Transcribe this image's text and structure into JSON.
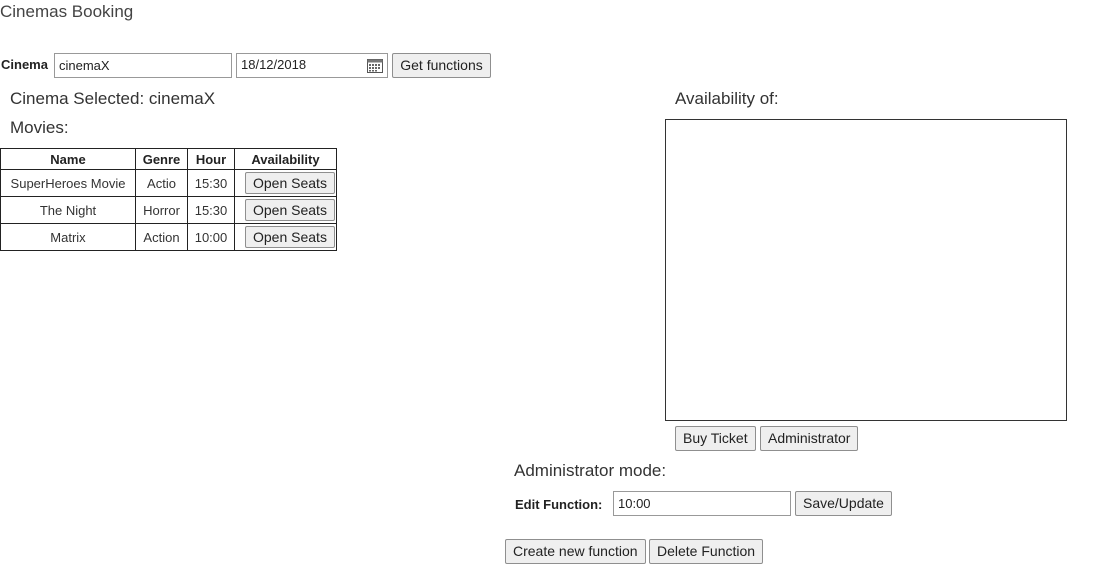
{
  "app": {
    "title": "Cinemas Booking"
  },
  "search": {
    "cinema_label": "Cinema",
    "cinema_value": "cinemaX",
    "date_value": "18/12/2018",
    "get_functions_label": "Get functions"
  },
  "selection": {
    "cinema_selected_text": "Cinema Selected: cinemaX",
    "movies_heading": "Movies:"
  },
  "movies_table": {
    "headers": [
      "Name",
      "Genre",
      "Hour",
      "Availability"
    ],
    "rows": [
      {
        "name": "SuperHeroes Movie",
        "genre": "Actio",
        "hour": "15:30",
        "action": "Open Seats"
      },
      {
        "name": "The Night",
        "genre": "Horror",
        "hour": "15:30",
        "action": "Open Seats"
      },
      {
        "name": "Matrix",
        "genre": "Action",
        "hour": "10:00",
        "action": "Open Seats"
      }
    ]
  },
  "availability": {
    "heading": "Availability of:",
    "buy_ticket_label": "Buy Ticket",
    "administrator_label": "Administrator"
  },
  "admin": {
    "heading": "Administrator mode:",
    "edit_function_label": "Edit Function:",
    "edit_function_value": "10:00",
    "save_update_label": "Save/Update",
    "create_function_label": "Create new function",
    "delete_function_label": "Delete Function"
  },
  "icons": {
    "date_picker": "calendar-icon"
  }
}
